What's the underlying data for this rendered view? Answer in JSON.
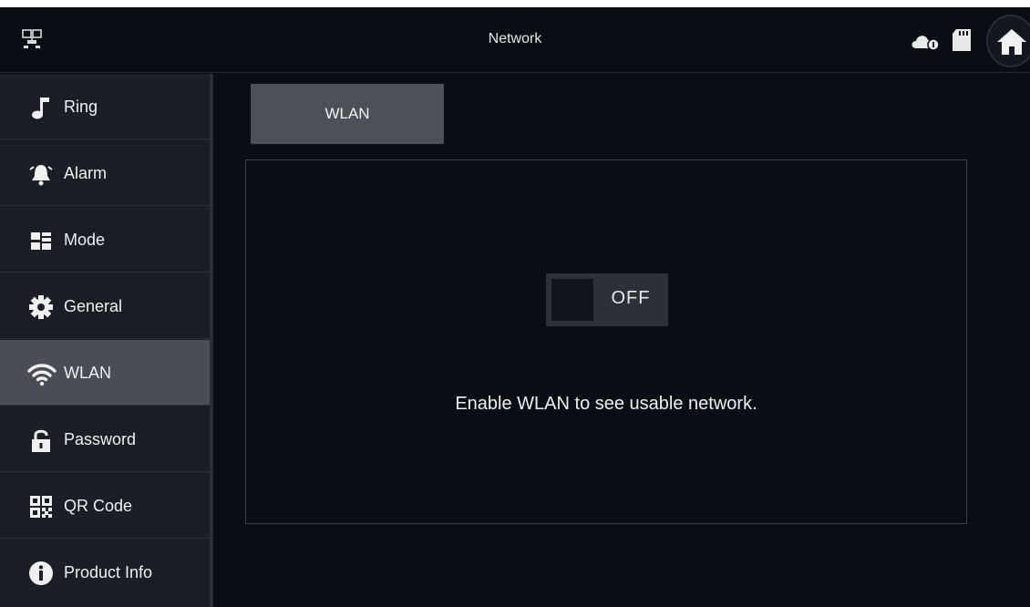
{
  "header": {
    "title": "Network"
  },
  "sidebar": {
    "items": [
      {
        "label": "Ring",
        "icon": "music-note-icon",
        "active": false
      },
      {
        "label": "Alarm",
        "icon": "alarm-bell-icon",
        "active": false
      },
      {
        "label": "Mode",
        "icon": "mode-grid-icon",
        "active": false
      },
      {
        "label": "General",
        "icon": "gear-icon",
        "active": false
      },
      {
        "label": "WLAN",
        "icon": "wifi-icon",
        "active": true
      },
      {
        "label": "Password",
        "icon": "lock-icon",
        "active": false
      },
      {
        "label": "QR Code",
        "icon": "qr-code-icon",
        "active": false
      },
      {
        "label": "Product Info",
        "icon": "info-icon",
        "active": false
      }
    ]
  },
  "main": {
    "tab_label": "WLAN",
    "toggle_state": "OFF",
    "hint": "Enable WLAN to see usable network."
  },
  "colors": {
    "background": "#0b0d14",
    "sidebar": "#1b1e27",
    "active_item": "#4a4d56",
    "tab": "#4d5059"
  }
}
